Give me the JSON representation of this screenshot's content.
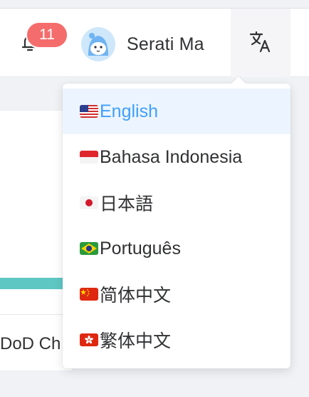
{
  "header": {
    "notifications": {
      "count": "11",
      "icon": "bell-icon"
    },
    "user": {
      "name": "Serati Ma",
      "avatar": "avatar-cartoon"
    },
    "language_button": {
      "icon": "translate-icon"
    }
  },
  "background": {
    "card_text": "DoD Ch",
    "accent": "#5fc7c3"
  },
  "language_menu": {
    "active_color": "#409eff",
    "items": [
      {
        "flag": "us-flag",
        "label": "English",
        "active": true
      },
      {
        "flag": "id-flag",
        "label": "Bahasa Indonesia",
        "active": false
      },
      {
        "flag": "jp-flag",
        "label": "日本語",
        "active": false
      },
      {
        "flag": "br-flag",
        "label": "Português",
        "active": false
      },
      {
        "flag": "cn-flag",
        "label": "简体中文",
        "active": false
      },
      {
        "flag": "hk-flag",
        "label": "繁体中文",
        "active": false
      }
    ]
  }
}
